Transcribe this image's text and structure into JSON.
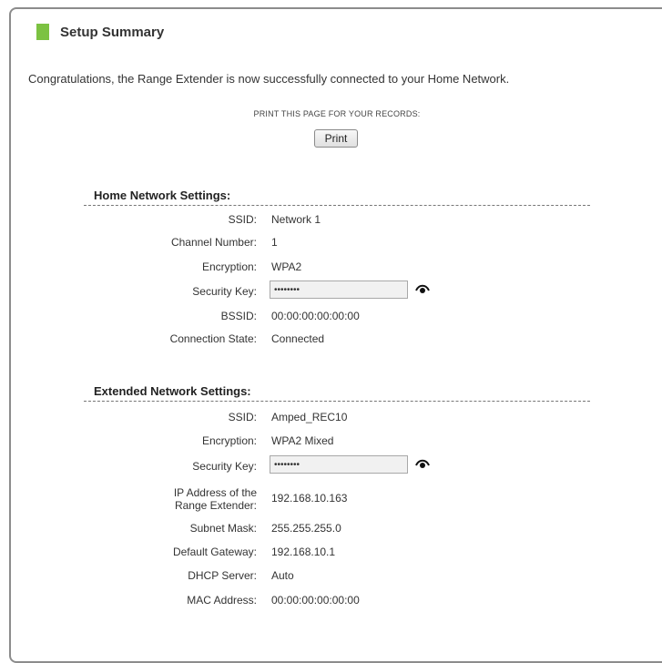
{
  "header": {
    "title": "Setup Summary"
  },
  "message": "Congratulations, the Range Extender is now successfully connected to your Home Network.",
  "print_note": "PRINT THIS PAGE FOR YOUR RECORDS:",
  "print_label": "Print",
  "home": {
    "heading": "Home Network Settings:",
    "ssid_label": "SSID:",
    "ssid": "Network 1",
    "channel_label": "Channel Number:",
    "channel": "1",
    "encryption_label": "Encryption:",
    "encryption": "WPA2",
    "key_label": "Security Key:",
    "key_value": "••••••••",
    "bssid_label": "BSSID:",
    "bssid": "00:00:00:00:00:00",
    "state_label": "Connection State:",
    "state": "Connected"
  },
  "extended": {
    "heading": "Extended Network Settings:",
    "ssid_label": "SSID:",
    "ssid": "Amped_REC10",
    "encryption_label": "Encryption:",
    "encryption": "WPA2 Mixed",
    "key_label": "Security Key:",
    "key_value": "••••••••",
    "ip_label": "IP Address of the Range Extender:",
    "ip": "192.168.10.163",
    "subnet_label": "Subnet Mask:",
    "subnet": "255.255.255.0",
    "gateway_label": "Default Gateway:",
    "gateway": "192.168.10.1",
    "dhcp_label": "DHCP Server:",
    "dhcp": "Auto",
    "mac_label": "MAC Address:",
    "mac": "00:00:00:00:00:00"
  },
  "icons": {
    "show_key": "eye-icon"
  },
  "colors": {
    "accent": "#7cc242"
  }
}
